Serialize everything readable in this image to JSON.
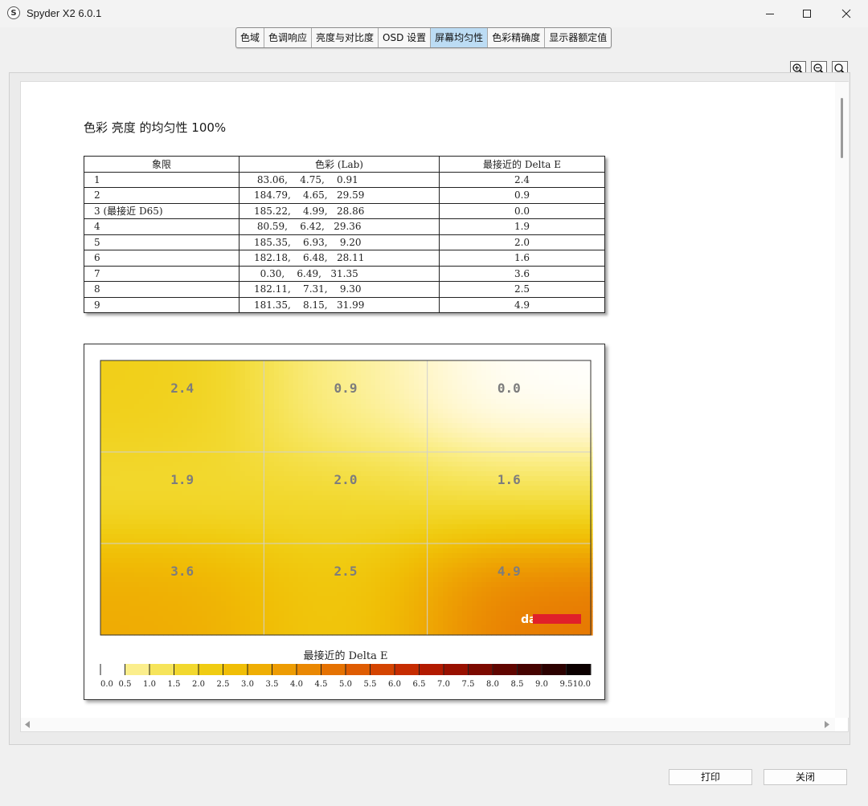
{
  "window": {
    "title": "Spyder X2 6.0.1",
    "icon_letter": "S"
  },
  "tabs": [
    {
      "label": "色域"
    },
    {
      "label": "色调响应"
    },
    {
      "label": "亮度与对比度"
    },
    {
      "label": "OSD 设置"
    },
    {
      "label": "屏幕均匀性",
      "active": true
    },
    {
      "label": "色彩精确度"
    },
    {
      "label": "显示器额定值"
    }
  ],
  "report": {
    "title": "色彩 亮度 的均匀性 100%",
    "table": {
      "headers": [
        "象限",
        "色彩 (Lab)",
        "最接近的 Delta E"
      ],
      "rows": [
        {
          "quadrant": "1",
          "lab": " 83.06,    4.75,    0.91",
          "delta_e": "2.4"
        },
        {
          "quadrant": "2",
          "lab": "184.79,    4.65,   29.59",
          "delta_e": "0.9"
        },
        {
          "quadrant": "3 (最接近 D65)",
          "lab": "185.22,    4.99,   28.86",
          "delta_e": "0.0"
        },
        {
          "quadrant": "4",
          "lab": " 80.59,    6.42,   29.36",
          "delta_e": "1.9"
        },
        {
          "quadrant": "5",
          "lab": "185.35,    6.93,    9.20",
          "delta_e": "2.0"
        },
        {
          "quadrant": "6",
          "lab": "182.18,    6.48,   28.11",
          "delta_e": "1.6"
        },
        {
          "quadrant": "7",
          "lab": "  0.30,    6.49,   31.35",
          "delta_e": "3.6"
        },
        {
          "quadrant": "8",
          "lab": "182.11,    7.31,    9.30",
          "delta_e": "2.5"
        },
        {
          "quadrant": "9",
          "lab": "181.35,    8.15,   31.99",
          "delta_e": "4.9"
        }
      ]
    }
  },
  "chart_data": {
    "type": "heatmap",
    "grid": {
      "rows": 3,
      "cols": 3
    },
    "values": [
      [
        2.4,
        0.9,
        0.0
      ],
      [
        1.9,
        2.0,
        1.6
      ],
      [
        3.6,
        2.5,
        4.9
      ]
    ],
    "labels": [
      [
        "2.4",
        "0.9",
        "0.0"
      ],
      [
        "1.9",
        "2.0",
        "1.6"
      ],
      [
        "3.6",
        "2.5",
        "4.9"
      ]
    ],
    "colorbar": {
      "title": "最接近的 Delta E",
      "range": [
        0,
        10
      ],
      "ticks": [
        "0.0",
        "0.5",
        "1.0",
        "1.5",
        "2.0",
        "2.5",
        "3.0",
        "3.5",
        "4.0",
        "4.5",
        "5.0",
        "5.5",
        "6.0",
        "6.5",
        "7.0",
        "7.5",
        "8.0",
        "8.5",
        "9.0",
        "9.5",
        "10.0"
      ],
      "colors": [
        "#ffffff",
        "#fff6c8",
        "#fbee8c",
        "#f6e45a",
        "#f2d82e",
        "#f0cc12",
        "#f0be06",
        "#efae04",
        "#ed9c03",
        "#ea8803",
        "#e57202",
        "#df5c02",
        "#d44401",
        "#c62c01",
        "#b21a00",
        "#981000",
        "#7c0a00",
        "#600500",
        "#460300",
        "#2c0100",
        "#000000"
      ]
    },
    "watermark": "datacolor",
    "accent_color": "#e0202a"
  },
  "buttons": {
    "print": "打印",
    "close": "关闭"
  }
}
